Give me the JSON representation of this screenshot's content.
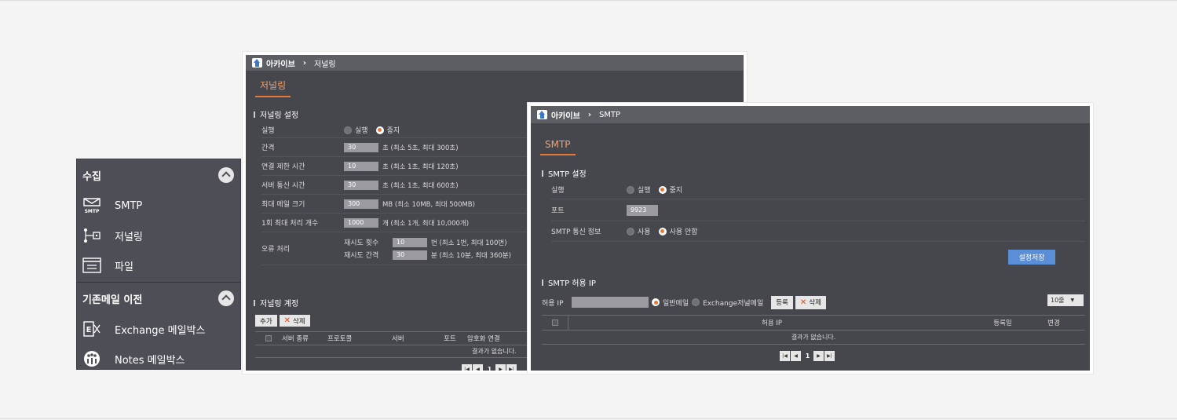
{
  "sidebar": {
    "collect_title": "수집",
    "items": [
      {
        "label": "SMTP",
        "icon": "smtp-mail-icon",
        "badge": "SMTP"
      },
      {
        "label": "저널링",
        "icon": "journaling-network-icon"
      },
      {
        "label": "파일",
        "icon": "file-window-icon"
      }
    ],
    "migration_title": "기존메일 이전",
    "migration_items": [
      {
        "label": "Exchange 메일박스",
        "icon": "exchange-icon"
      },
      {
        "label": "Notes 메일박스",
        "icon": "notes-icon"
      }
    ]
  },
  "journal_window": {
    "breadcrumb_app": "아카이브",
    "breadcrumb_page": "저널링",
    "tab": "저널링",
    "settings_title": "저널링 설정",
    "run_label": "실행",
    "run_option": "실행",
    "stop_option": "중지",
    "rows": [
      {
        "label": "간격",
        "value": "30",
        "hint": "초 (최소 5초, 최대 300초)"
      },
      {
        "label": "연결 제한 시간",
        "value": "10",
        "hint": "초 (최소 1초, 최대 120초)"
      },
      {
        "label": "서버 통신 시간",
        "value": "30",
        "hint": "초 (최소 1초, 최대 600초)"
      },
      {
        "label": "최대 메일 크기",
        "value": "300",
        "hint": "MB (최소 10MB, 최대 500MB)"
      },
      {
        "label": "1회 최대 처리 개수",
        "value": "1000",
        "hint": "개 (최소 1개, 최대 10,000개)"
      }
    ],
    "error_label": "오류 처리",
    "retry_count_label": "재시도 횟수",
    "retry_count_value": "10",
    "retry_count_hint": "번 (최소 1번, 최대 100번)",
    "retry_interval_label": "재시도 간격",
    "retry_interval_value": "30",
    "retry_interval_hint": "분 (최소 10분, 최대 360분)",
    "account_title": "저널링 계정",
    "add_button": "추가",
    "delete_button": "삭제",
    "columns": [
      "서버 종류",
      "프로토콜",
      "서버",
      "포트",
      "암호화 연결"
    ],
    "empty_text": "결과가 없습니다.",
    "page": "1"
  },
  "smtp_window": {
    "breadcrumb_app": "아카이브",
    "breadcrumb_page": "SMTP",
    "tab": "SMTP",
    "settings_title": "SMTP 설정",
    "run_label": "실행",
    "run_option": "실행",
    "stop_option": "중지",
    "port_label": "포트",
    "port_value": "9923",
    "comm_label": "SMTP 통신 정보",
    "comm_use": "사용",
    "comm_nouse": "사용 안함",
    "save_button": "설정저장",
    "allow_title": "SMTP 허용 IP",
    "allow_ip_label": "허용 IP",
    "allow_ip_value": "",
    "normal_mail": "일반메일",
    "exchange_mail": "Exchange저널메일",
    "register_button": "등록",
    "delete_button": "삭제",
    "rows_select": "10줄",
    "columns": [
      "허용 IP",
      "등록일",
      "변경"
    ],
    "empty_text": "결과가 없습니다.",
    "page": "1"
  }
}
